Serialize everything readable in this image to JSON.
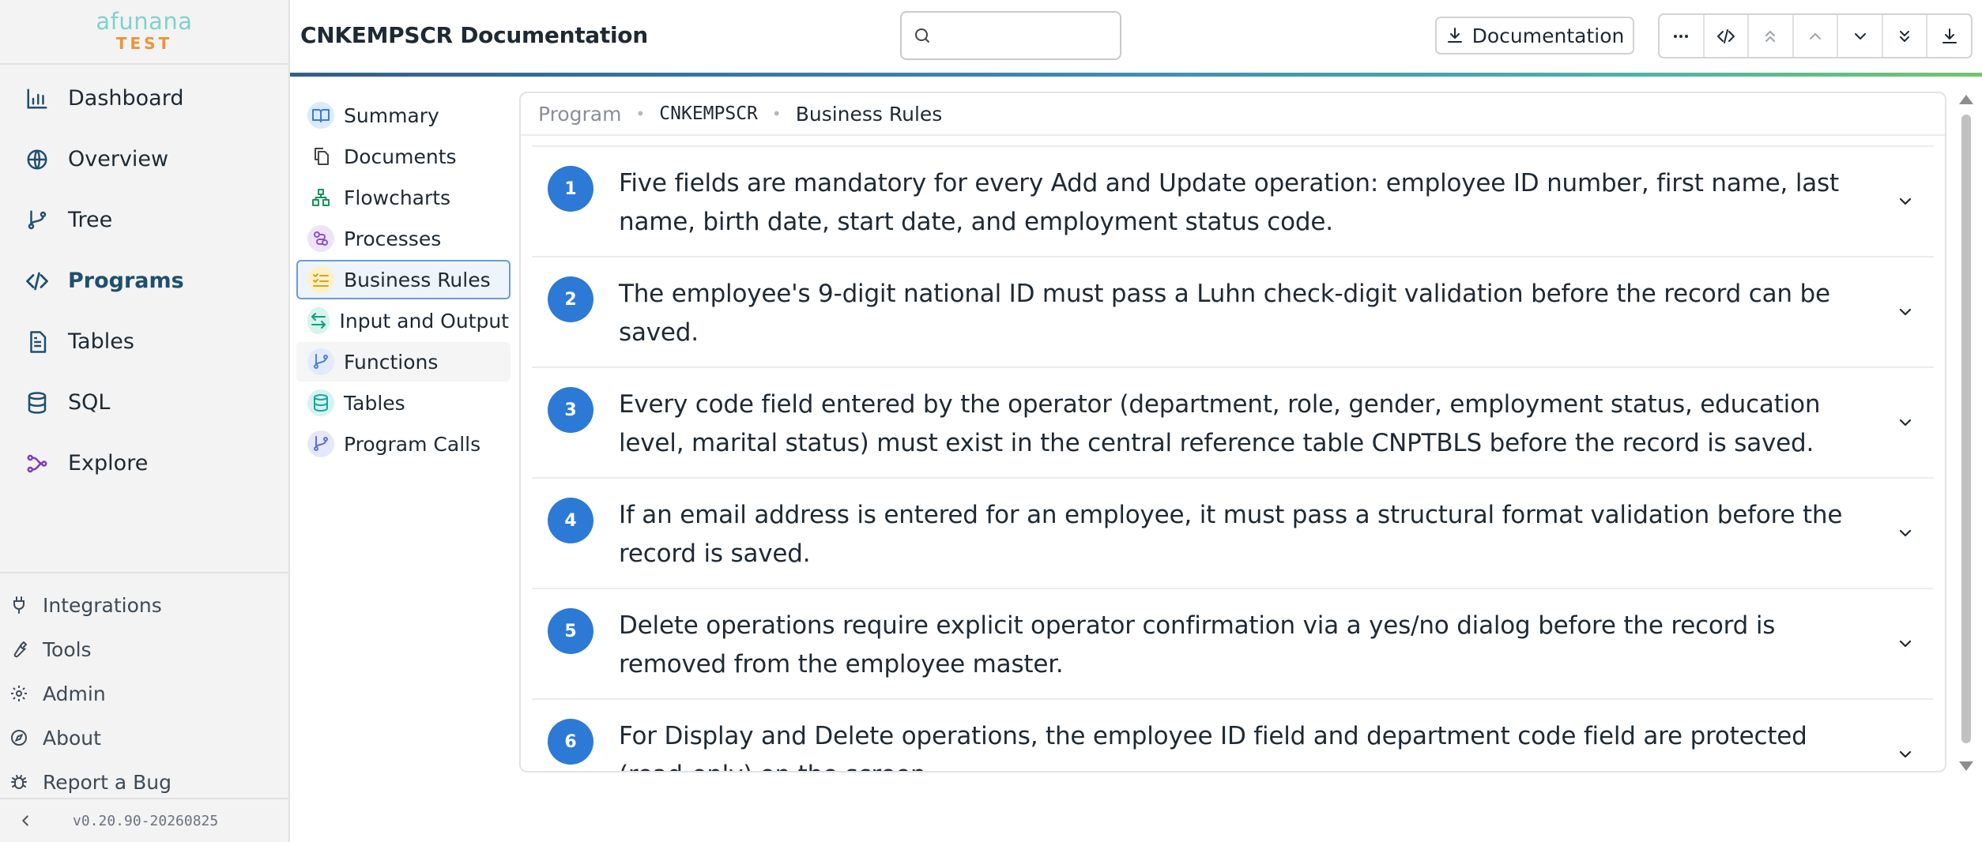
{
  "brand": {
    "name": "afunana",
    "env": "TEST"
  },
  "sidebar": {
    "items": [
      {
        "label": "Dashboard",
        "icon": "bar-chart-icon",
        "active": false
      },
      {
        "label": "Overview",
        "icon": "globe-icon",
        "active": false
      },
      {
        "label": "Tree",
        "icon": "git-branch-icon",
        "active": false
      },
      {
        "label": "Programs",
        "icon": "code-icon",
        "active": true
      },
      {
        "label": "Tables",
        "icon": "file-text-icon",
        "active": false
      },
      {
        "label": "SQL",
        "icon": "database-icon",
        "active": false
      },
      {
        "label": "Explore",
        "icon": "workflow-icon",
        "active": false
      }
    ],
    "bottom_items": [
      {
        "label": "Integrations",
        "icon": "plug-icon"
      },
      {
        "label": "Tools",
        "icon": "wrench-icon"
      },
      {
        "label": "Admin",
        "icon": "gear-icon"
      },
      {
        "label": "About",
        "icon": "compass-icon"
      },
      {
        "label": "Report a Bug",
        "icon": "bug-icon"
      }
    ],
    "version": "v0.20.90-20260825"
  },
  "header": {
    "title": "CNKEMPSCR Documentation",
    "search_placeholder": "",
    "doc_button_label": "Documentation"
  },
  "toolbar": [
    {
      "icon": "more-horizontal-icon"
    },
    {
      "icon": "code-icon"
    },
    {
      "icon": "chevrons-up-icon"
    },
    {
      "icon": "chevron-up-icon"
    },
    {
      "icon": "chevron-down-icon"
    },
    {
      "icon": "chevrons-down-icon"
    },
    {
      "icon": "download-icon"
    }
  ],
  "subnav": {
    "items": [
      {
        "label": "Summary",
        "icon": "book-open-icon",
        "color": "#3a7bd5",
        "bg": "#dbeafe",
        "active": false
      },
      {
        "label": "Documents",
        "icon": "files-icon",
        "color": "#444444",
        "bg": "transparent",
        "active": false
      },
      {
        "label": "Flowcharts",
        "icon": "shapes-icon",
        "color": "#15935a",
        "bg": "transparent",
        "active": false
      },
      {
        "label": "Processes",
        "icon": "route-icon",
        "color": "#8b4fc9",
        "bg": "#ede4fb",
        "active": false
      },
      {
        "label": "Business Rules",
        "icon": "list-checks-icon",
        "color": "#d9a21b",
        "bg": "#fdf1c7",
        "active": true
      },
      {
        "label": "Input and Output",
        "icon": "arrow-left-right-icon",
        "color": "#159b7d",
        "bg": "#d4f4ec",
        "active": false
      },
      {
        "label": "Functions",
        "icon": "git-branch-icon",
        "color": "#4f7fd6",
        "bg": "#e3ebfb",
        "active": false,
        "hover": true
      },
      {
        "label": "Tables",
        "icon": "database-icon",
        "color": "#17a6a0",
        "bg": "#d6f3f1",
        "active": false
      },
      {
        "label": "Program Calls",
        "icon": "git-branch-icon",
        "color": "#5b6fd9",
        "bg": "#e5e8fb",
        "active": false
      }
    ]
  },
  "breadcrumb": {
    "level1": "Program",
    "level2": "CNKEMPSCR",
    "level3": "Business Rules"
  },
  "rules": [
    {
      "number": "1",
      "text": "Five fields are mandatory for every Add and Update operation: employee ID number, first name, last name, birth date, start date, and employment status code."
    },
    {
      "number": "2",
      "text": "The employee's 9-digit national ID must pass a Luhn check-digit validation before the record can be saved."
    },
    {
      "number": "3",
      "text": "Every code field entered by the operator (department, role, gender, employment status, education level, marital status) must exist in the central reference table CNPTBLS before the record is saved."
    },
    {
      "number": "4",
      "text": "If an email address is entered for an employee, it must pass a structural format validation before the record is saved."
    },
    {
      "number": "5",
      "text": "Delete operations require explicit operator confirmation via a yes/no dialog before the record is removed from the employee master."
    },
    {
      "number": "6",
      "text": "For Display and Delete operations, the employee ID field and department code field are protected (read-only) on the screen."
    }
  ],
  "colors": {
    "accent": "#2c7ad6",
    "nav_active": "#1f4f6e",
    "brand_primary": "#7ed3cc",
    "brand_env": "#e8953a"
  }
}
